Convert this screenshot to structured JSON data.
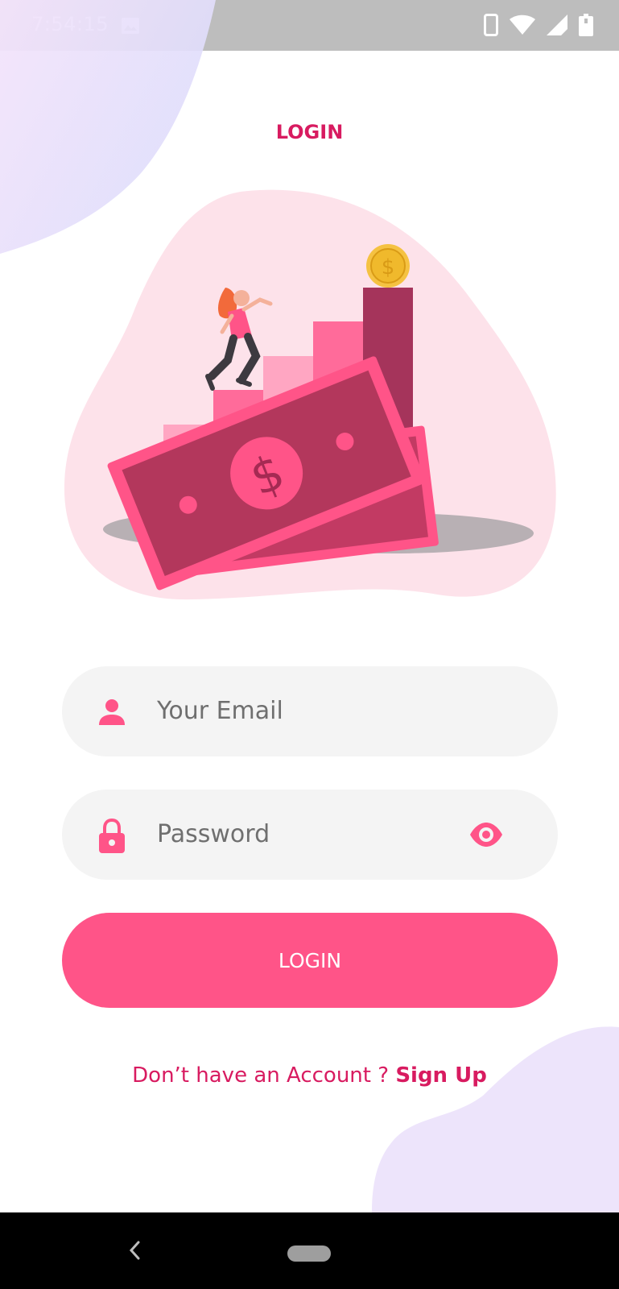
{
  "status_bar": {
    "time": "7:54:15",
    "icons": [
      "image-icon",
      "phone-icon",
      "wifi-icon",
      "signal-icon",
      "battery-icon"
    ]
  },
  "title": "LOGIN",
  "email_field": {
    "placeholder": "Your Email",
    "icon": "person-icon"
  },
  "password_field": {
    "placeholder": "Password",
    "icon": "lock-icon",
    "toggle_icon": "eye-icon"
  },
  "login_button": {
    "label": "LOGIN"
  },
  "signup": {
    "prompt": "Don’t have an Account ? ",
    "link": "Sign Up"
  },
  "colors": {
    "accent": "#ff5488",
    "title": "#d81b60",
    "field_bg": "#f4f4f4",
    "placeholder": "#6f6f6f",
    "blob_purple": "#ede4fb",
    "blob_pink": "#fde2ea"
  },
  "navigation": {
    "icons": [
      "back-icon",
      "home-pill-icon"
    ]
  }
}
